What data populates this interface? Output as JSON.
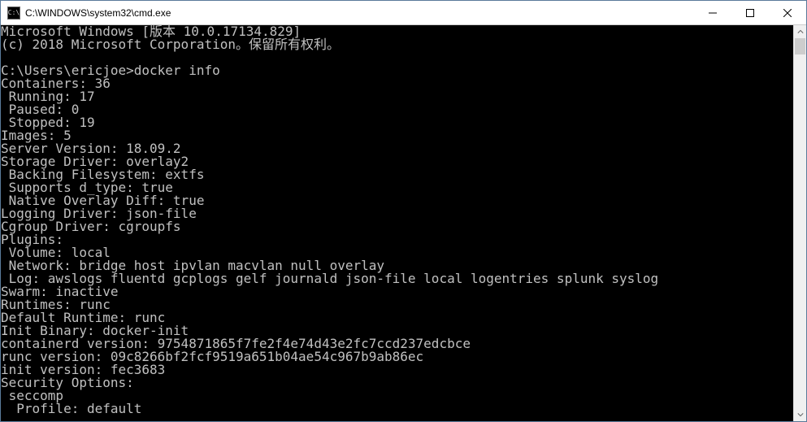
{
  "titlebar": {
    "icon_label": "C:\\",
    "title": "C:\\WINDOWS\\system32\\cmd.exe"
  },
  "console": {
    "lines": [
      "Microsoft Windows [版本 10.0.17134.829]",
      "(c) 2018 Microsoft Corporation。保留所有权利。",
      "",
      "C:\\Users\\ericjoe>docker info",
      "Containers: 36",
      " Running: 17",
      " Paused: 0",
      " Stopped: 19",
      "Images: 5",
      "Server Version: 18.09.2",
      "Storage Driver: overlay2",
      " Backing Filesystem: extfs",
      " Supports d_type: true",
      " Native Overlay Diff: true",
      "Logging Driver: json-file",
      "Cgroup Driver: cgroupfs",
      "Plugins:",
      " Volume: local",
      " Network: bridge host ipvlan macvlan null overlay",
      " Log: awslogs fluentd gcplogs gelf journald json-file local logentries splunk syslog",
      "Swarm: inactive",
      "Runtimes: runc",
      "Default Runtime: runc",
      "Init Binary: docker-init",
      "containerd version: 9754871865f7fe2f4e74d43e2fc7ccd237edcbce",
      "runc version: 09c8266bf2fcf9519a651b04ae54c967b9ab86ec",
      "init version: fec3683",
      "Security Options:",
      " seccomp",
      "  Profile: default"
    ]
  }
}
